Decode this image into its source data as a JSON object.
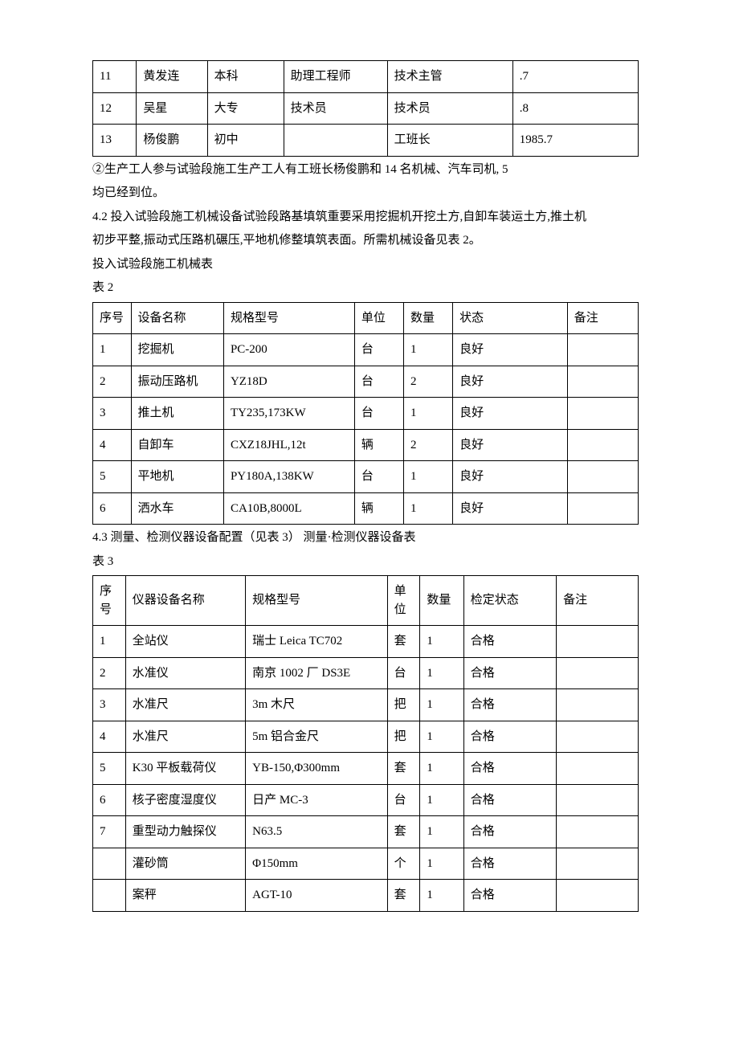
{
  "table1": {
    "rows": [
      {
        "c1": "11",
        "c2": "黄发连",
        "c3": "本科",
        "c4": "助理工程师",
        "c5": "技术主管",
        "c6": ".7"
      },
      {
        "c1": "12",
        "c2": "吴星",
        "c3": "大专",
        "c4": "技术员",
        "c5": "技术员",
        "c6": ".8"
      },
      {
        "c1": "13",
        "c2": "杨俊鹏",
        "c3": "初中",
        "c4": "",
        "c5": "工班长",
        "c6": "1985.7"
      }
    ]
  },
  "paras": {
    "p1": "②生产工人参与试验段施工生产工人有工班长杨俊鹏和 14  名机械、汽车司机, 5",
    "p2": "均已经到位。",
    "p3": "4.2  投入试验段施工机械设备试验段路基填筑重要采用挖掘机开挖土方,自卸车装运土方,推土机",
    "p4": "初步平整,振动式压路机碾压,平地机修整填筑表面。所需机械设备见表 2。",
    "p5": "投入试验段施工机械表",
    "p6": "表 2",
    "p7": "4.3  测量、检测仪器设备配置（见表 3）  测量·检测仪器设备表",
    "p8": "表 3"
  },
  "table2": {
    "header": {
      "c1": "序号",
      "c2": "设备名称",
      "c3": "规格型号",
      "c4": "单位",
      "c5": "数量",
      "c6": "状态",
      "c7": "备注"
    },
    "rows": [
      {
        "c1": "1",
        "c2": "挖掘机",
        "c3": "PC-200",
        "c4": "台",
        "c5": "1",
        "c6": "良好",
        "c7": ""
      },
      {
        "c1": "2",
        "c2": "振动压路机",
        "c3": "YZ18D",
        "c4": "台",
        "c5": "2",
        "c6": "良好",
        "c7": ""
      },
      {
        "c1": "3",
        "c2": "推土机",
        "c3": "TY235,173KW",
        "c4": "台",
        "c5": "1",
        "c6": "良好",
        "c7": ""
      },
      {
        "c1": "4",
        "c2": "自卸车",
        "c3": "CXZ18JHL,12t",
        "c4": "辆",
        "c5": "2",
        "c6": "良好",
        "c7": ""
      },
      {
        "c1": "5",
        "c2": "平地机",
        "c3": "PY180A,138KW",
        "c4": "台",
        "c5": "1",
        "c6": "良好",
        "c7": ""
      },
      {
        "c1": "6",
        "c2": "洒水车",
        "c3": "CA10B,8000L",
        "c4": "辆",
        "c5": "1",
        "c6": "良好",
        "c7": ""
      }
    ]
  },
  "table3": {
    "header": {
      "c1": "序号",
      "c2": "仪器设备名称",
      "c3": "规格型号",
      "c4": "单位",
      "c5": "数量",
      "c6": "检定状态",
      "c7": "备注"
    },
    "rows": [
      {
        "c1": "1",
        "c2": "全站仪",
        "c3": "瑞士 Leica TC702",
        "c4": "套",
        "c5": "1",
        "c6": "合格",
        "c7": ""
      },
      {
        "c1": "2",
        "c2": "水准仪",
        "c3": "南京 1002  厂 DS3E",
        "c4": "台",
        "c5": "1",
        "c6": "合格",
        "c7": ""
      },
      {
        "c1": "3",
        "c2": "水准尺",
        "c3": "3m  木尺",
        "c4": "把",
        "c5": "1",
        "c6": "合格",
        "c7": ""
      },
      {
        "c1": "4",
        "c2": "水准尺",
        "c3": "5m  铝合金尺",
        "c4": "把",
        "c5": "1",
        "c6": "合格",
        "c7": ""
      },
      {
        "c1": "5",
        "c2": "K30  平板载荷仪",
        "c3": "YB-150,Φ300mm",
        "c4": "套",
        "c5": "1",
        "c6": "合格",
        "c7": ""
      },
      {
        "c1": "6",
        "c2": "核子密度湿度仪",
        "c3": "日产 MC-3",
        "c4": "台",
        "c5": "1",
        "c6": "合格",
        "c7": ""
      },
      {
        "c1": "7",
        "c2": "重型动力触探仪",
        "c3": "N63.5",
        "c4": "套",
        "c5": "1",
        "c6": "合格",
        "c7": ""
      },
      {
        "c1": "",
        "c2": "灌砂筒",
        "c3": "Φ150mm",
        "c4": "个",
        "c5": "1",
        "c6": "合格",
        "c7": ""
      },
      {
        "c1": "",
        "c2": "案秤",
        "c3": "AGT-10",
        "c4": "套",
        "c5": "1",
        "c6": "合格",
        "c7": ""
      }
    ]
  }
}
